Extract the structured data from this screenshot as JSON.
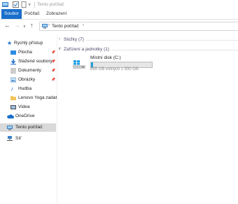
{
  "window": {
    "title": "Tento počítač"
  },
  "ribbon": {
    "tabs": [
      "Soubor",
      "Počítač",
      "Zobrazení"
    ]
  },
  "address": {
    "path": "Tento počítač"
  },
  "sidebar": {
    "quick_access": "Rychlý přístup",
    "quick_items": [
      {
        "label": "Plocha",
        "pinned": true
      },
      {
        "label": "Stažené soubory",
        "pinned": true
      },
      {
        "label": "Dokumenty",
        "pinned": true
      },
      {
        "label": "Obrázky",
        "pinned": true
      },
      {
        "label": "Hudba",
        "pinned": false
      },
      {
        "label": "Lenovo Yoga zadat",
        "pinned": false
      },
      {
        "label": "Videa",
        "pinned": false
      }
    ],
    "onedrive": "OneDrive",
    "this_pc": "Tento počítač",
    "network": "Síť"
  },
  "main": {
    "folders_header": "Složky (7)",
    "devices_header": "Zařízení a jednotky (1)",
    "drive": {
      "name": "Místní disk (C:)",
      "free_text": "895 GB volných z 930 GB",
      "used_fraction": 0.04
    }
  },
  "colors": {
    "accent": "#1a6fcb",
    "drive_fill": "#26a0da",
    "selection": "#d9d9d9"
  }
}
